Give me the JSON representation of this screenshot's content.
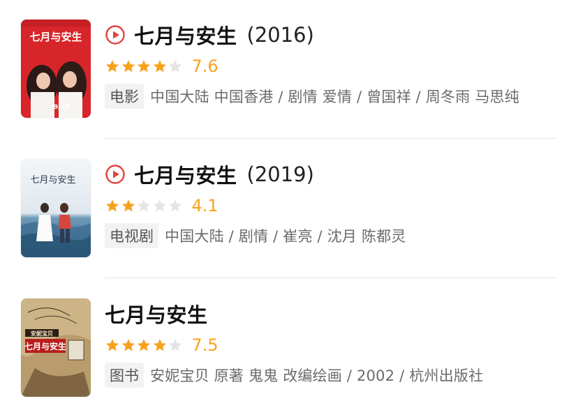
{
  "colors": {
    "accent_orange": "#f7a21b",
    "star_empty": "#e4e4e4",
    "play_red": "#e0443f",
    "tag_bg": "#f2f2f2",
    "meta_text": "#6b6b6b"
  },
  "results": [
    {
      "title": "七月与安生",
      "year": "(2016)",
      "has_play_icon": true,
      "rating_stars": 4,
      "score": "7.6",
      "tag": "电影",
      "meta": "中国大陆 中国香港 / 剧情 爱情 / 曾国祥 / 周冬雨 马思纯",
      "poster_text": "七月与安生",
      "poster_date": "9/14"
    },
    {
      "title": "七月与安生",
      "year": "(2019)",
      "has_play_icon": true,
      "rating_stars": 2,
      "score": "4.1",
      "tag": "电视剧",
      "meta": "中国大陆 / 剧情 / 崔亮 / 沈月 陈都灵",
      "poster_text": "七月与安生"
    },
    {
      "title": "七月与安生",
      "year": "",
      "has_play_icon": false,
      "rating_stars": 4,
      "score": "7.5",
      "tag": "图书",
      "meta": "安妮宝贝 原著 鬼鬼 改编绘画 / 2002 / 杭州出版社",
      "poster_text": "七月与安生",
      "poster_subtext": "安妮宝贝"
    }
  ]
}
